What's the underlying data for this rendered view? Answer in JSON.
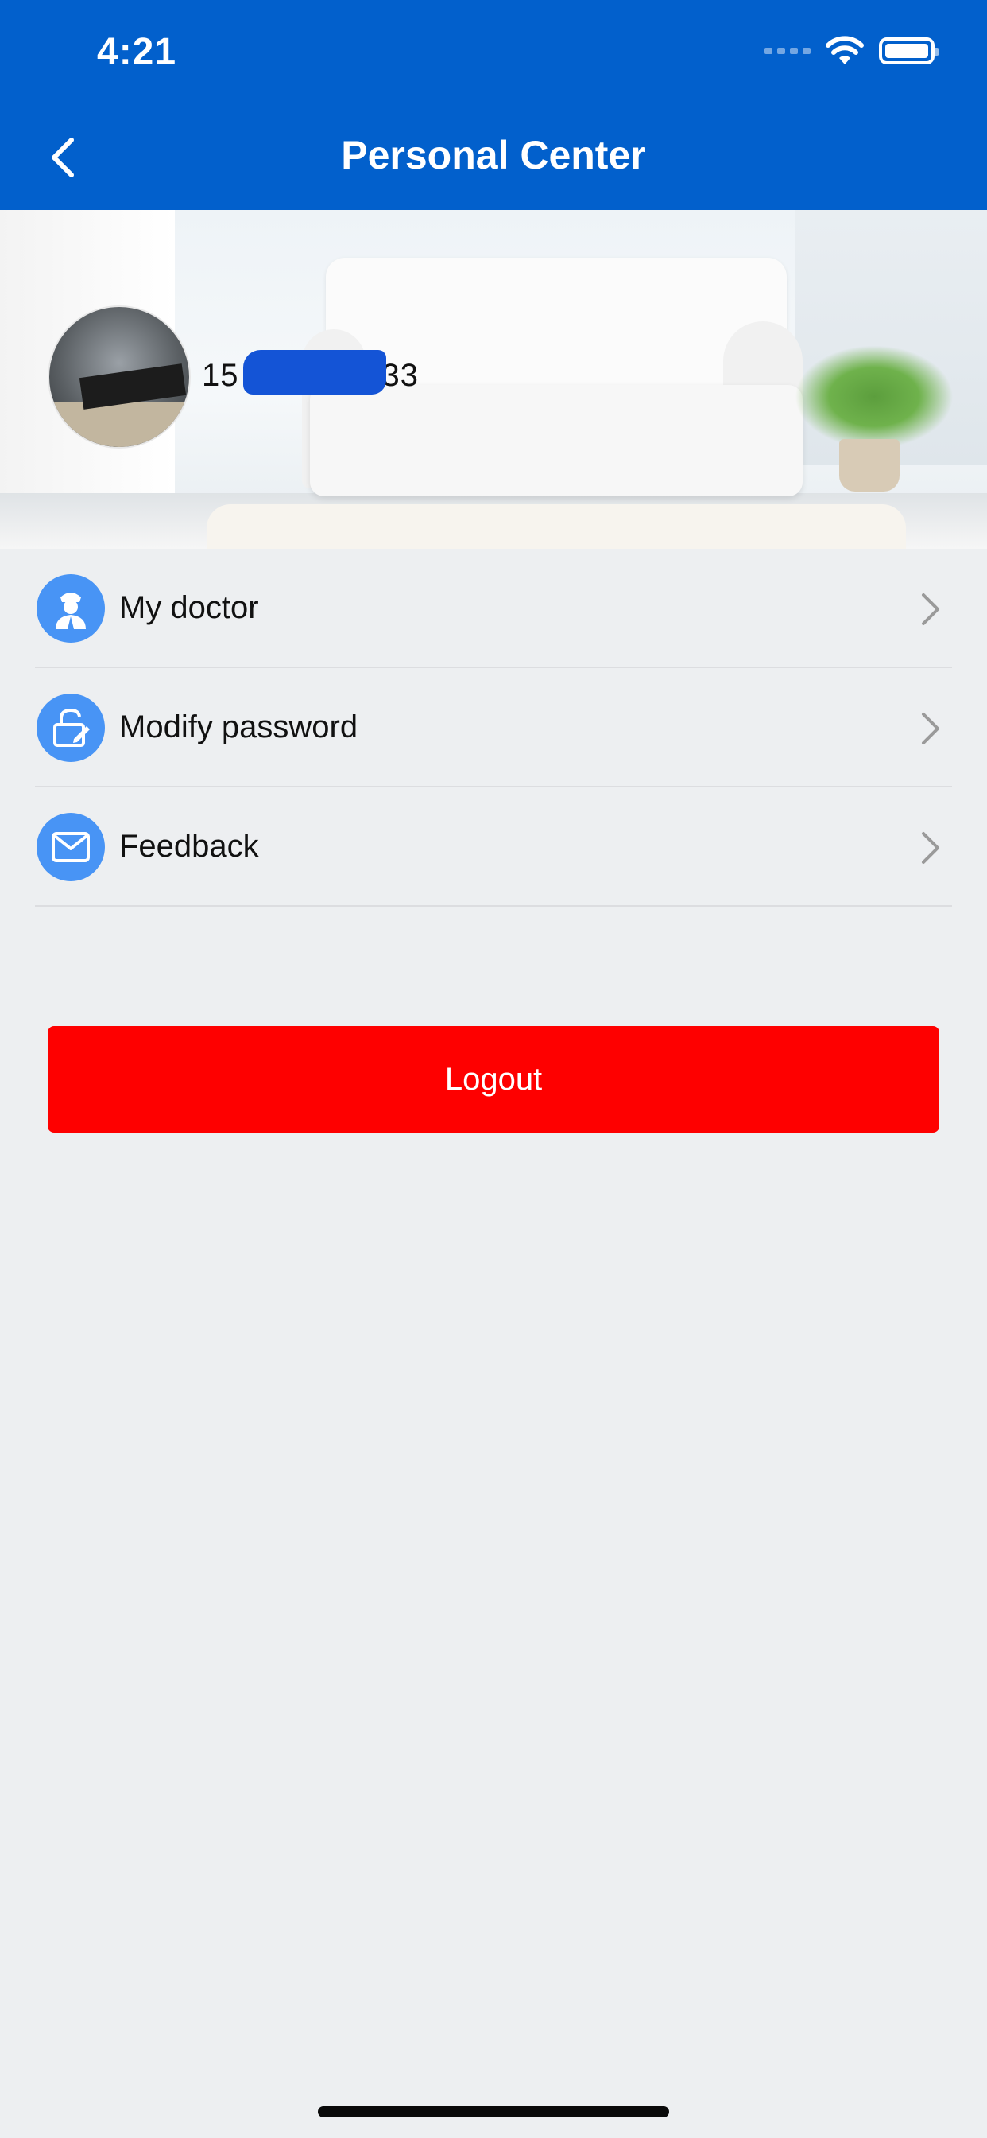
{
  "status_bar": {
    "time": "4:21",
    "wifi_icon": "wifi-icon",
    "battery_icon": "battery-icon"
  },
  "nav": {
    "title": "Personal Center",
    "back_icon": "chevron-left-icon",
    "bar_color": "#0260cc"
  },
  "profile": {
    "phone_prefix": "15",
    "phone_suffix": "33",
    "redacted": true
  },
  "menu": {
    "items": [
      {
        "label": "My doctor",
        "icon": "doctor-icon"
      },
      {
        "label": "Modify password",
        "icon": "lock-edit-icon"
      },
      {
        "label": "Feedback",
        "icon": "mail-icon"
      }
    ],
    "icon_color": "#4894f5"
  },
  "actions": {
    "logout_label": "Logout",
    "logout_color": "#fe0000"
  }
}
